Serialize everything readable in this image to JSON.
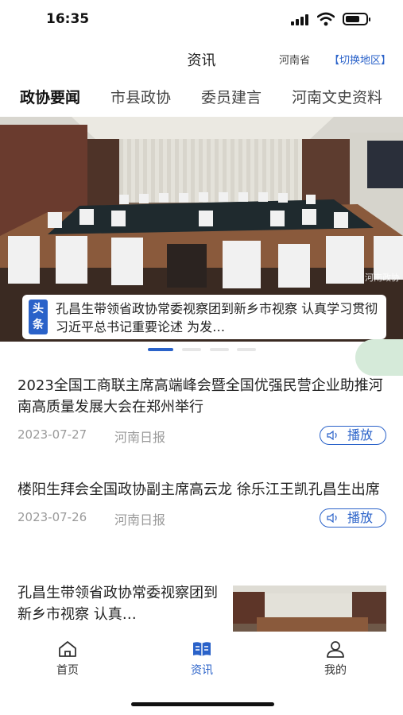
{
  "status_bar": {
    "time": "16:35",
    "icons": [
      "signal-icon",
      "wifi-icon",
      "battery-icon"
    ],
    "battery_level": 0.7
  },
  "header": {
    "title": "资讯",
    "region": "河南省",
    "switch_region": "【切换地区】"
  },
  "tabs": [
    {
      "label": "政协要闻",
      "active": true
    },
    {
      "label": "市县政协",
      "active": false
    },
    {
      "label": "委员建言",
      "active": false
    },
    {
      "label": "河南文史资料",
      "active": false
    }
  ],
  "carousel": {
    "badge": "头条",
    "caption": "孔昌生带领省政协常委视察团到新乡市视察 认真学习贯彻习近平总书记重要论述 为发…",
    "watermark": "河南政协",
    "slide_count": 4,
    "active_slide": 1
  },
  "news": [
    {
      "title": "2023全国工商联主席高端峰会暨全国优强民营企业助推河南高质量发展大会在郑州举行",
      "date": "2023-07-27",
      "source": "河南日报",
      "play_label": "播放"
    },
    {
      "title": "楼阳生拜会全国政协副主席高云龙 徐乐江王凯孔昌生出席",
      "date": "2023-07-26",
      "source": "河南日报",
      "play_label": "播放"
    },
    {
      "title": "孔昌生带领省政协常委视察团到新乡市视察 认真…"
    }
  ],
  "bottom_nav": [
    {
      "label": "首页",
      "icon": "home-icon",
      "active": false
    },
    {
      "label": "资讯",
      "icon": "news-book-icon",
      "active": true
    },
    {
      "label": "我的",
      "icon": "user-icon",
      "active": false
    }
  ],
  "colors": {
    "accent": "#2a62c9",
    "meta_text": "#9a9a9a",
    "float_bubble": "#d5ead9"
  }
}
